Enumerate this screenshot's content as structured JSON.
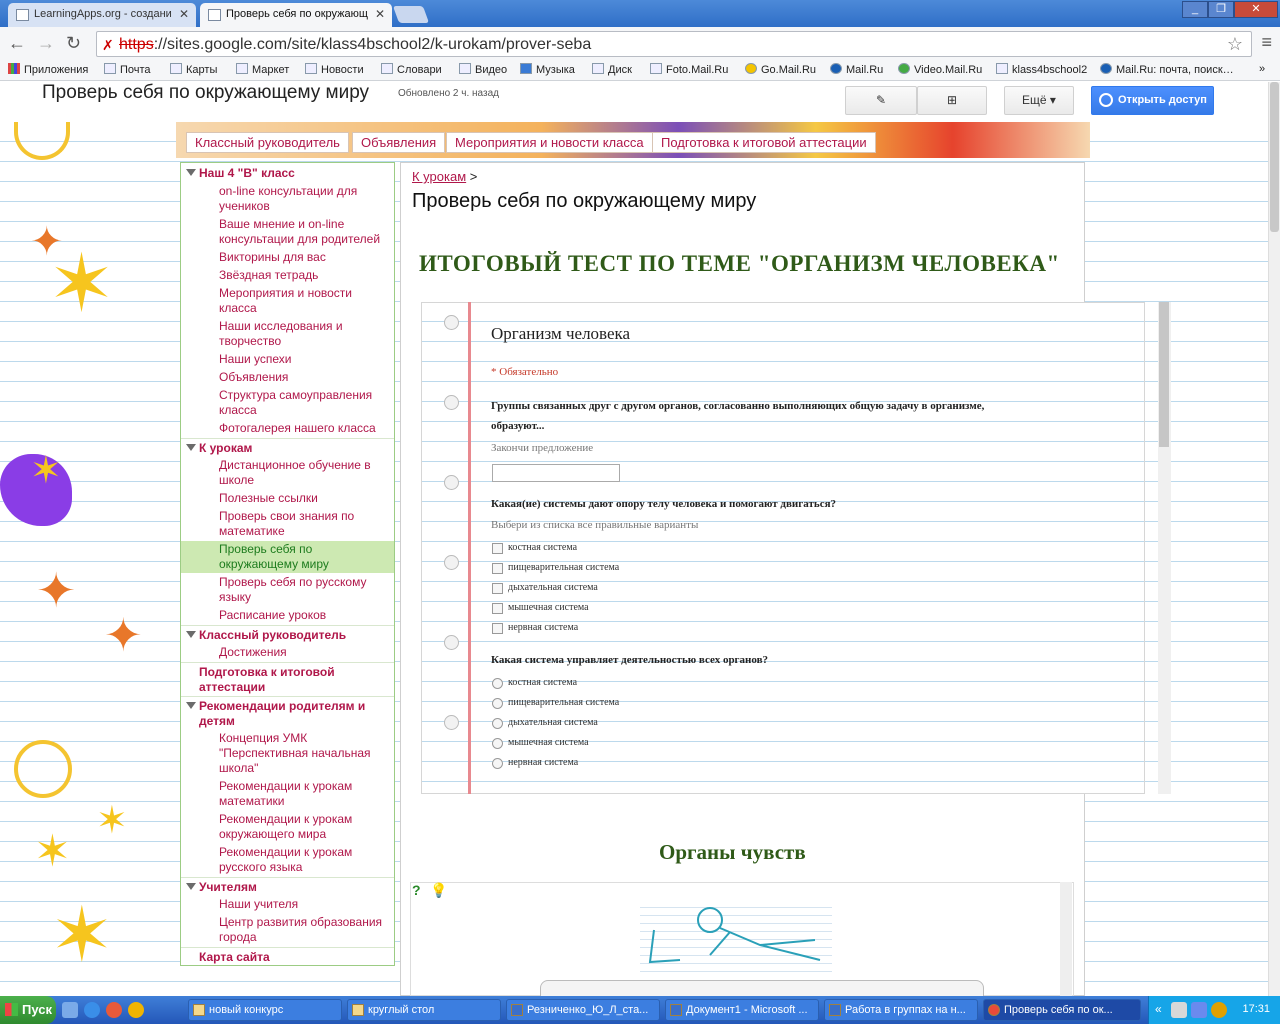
{
  "browser": {
    "tabs": [
      {
        "label": "LearningApps.org - создани",
        "active": false
      },
      {
        "label": "Проверь себя по окружающ",
        "active": true
      }
    ],
    "url_scheme": "https",
    "url_rest": "://sites.google.com/site/klass4bschool2/k-urokam/prover-seba",
    "bookmarks": [
      "Приложения",
      "Почта",
      "Карты",
      "Маркет",
      "Новости",
      "Словари",
      "Видео",
      "Музыка",
      "Диск",
      "Foto.Mail.Ru",
      "Go.Mail.Ru",
      "Mail.Ru",
      "Video.Mail.Ru",
      "klass4bschool2",
      "Mail.Ru: почта, поиск…"
    ],
    "bookmarks_more": "»"
  },
  "site": {
    "title": "Проверь себя по окружающему миру",
    "updated": "Обновлено 2 ч. назад",
    "more_label": "Ещё",
    "share_label": "Открыть доступ",
    "nav_tabs": [
      "Классный руководитель",
      "Объявления",
      "Мероприятия и новости класса",
      "Подготовка к итоговой аттестации"
    ]
  },
  "sidebar": {
    "items": [
      {
        "label": "Наш 4 \"В\" класс",
        "type": "head"
      },
      {
        "label": "on-line консультации для учеников",
        "type": "item"
      },
      {
        "label": "Ваше мнение и on-line консультации для родителей",
        "type": "item"
      },
      {
        "label": "Викторины для вас",
        "type": "item"
      },
      {
        "label": "Звёздная тетрадь",
        "type": "item"
      },
      {
        "label": "Мероприятия и новости класса",
        "type": "item"
      },
      {
        "label": "Наши исследования и творчество",
        "type": "item"
      },
      {
        "label": "Наши успехи",
        "type": "item"
      },
      {
        "label": "Объявления",
        "type": "item"
      },
      {
        "label": "Структура самоуправления класса",
        "type": "item"
      },
      {
        "label": "Фотогалерея нашего класса",
        "type": "item"
      },
      {
        "label": "К урокам",
        "type": "head"
      },
      {
        "label": "Дистанционное обучение в школе",
        "type": "item"
      },
      {
        "label": "Полезные ссылки",
        "type": "item"
      },
      {
        "label": "Проверь свои знания по математике",
        "type": "item"
      },
      {
        "label": "Проверь себя по окружающему миру",
        "type": "item"
      },
      {
        "label": "Проверь себя по русскому языку",
        "type": "item"
      },
      {
        "label": "Расписание уроков",
        "type": "item"
      },
      {
        "label": "Классный руководитель",
        "type": "head"
      },
      {
        "label": "Достижения",
        "type": "item"
      },
      {
        "label": "Подготовка к итоговой аттестации",
        "type": "head"
      },
      {
        "label": "Рекомендации родителям и детям",
        "type": "head"
      },
      {
        "label": "Концепция УМК \"Перспективная начальная школа\"",
        "type": "item"
      },
      {
        "label": "Рекомендации к урокам математики",
        "type": "item"
      },
      {
        "label": "Рекомендации к урокам окружающего мира",
        "type": "item"
      },
      {
        "label": "Рекомендации к урокам русского языка",
        "type": "item"
      },
      {
        "label": "Учителям",
        "type": "head"
      },
      {
        "label": "Наши учителя",
        "type": "item"
      },
      {
        "label": "Центр развития образования города",
        "type": "item"
      },
      {
        "label": "Карта сайта",
        "type": "head"
      }
    ]
  },
  "content": {
    "breadcrumb_link": "К урокам",
    "breadcrumb_sep": ">",
    "page_title": "Проверь себя по окружающему миру",
    "test_heading": "ИТОГОВЫЙ ТЕСТ ПО ТЕМЕ \"ОРГАНИЗМ ЧЕЛОВЕКА\"",
    "section2_heading": "Органы чувств"
  },
  "form": {
    "title": "Организм человека",
    "required_note": "* Обязательно",
    "q1": "Группы связанных друг с другом органов, согласованно выполняющих общую задачу в организме,",
    "q1_cont": "образуют...",
    "q1_help": "Закончи предложение",
    "q2": "Какая(ие) системы дают опору телу человека и помогают двигаться?",
    "q2_help": "Выбери из списка все правильные варианты",
    "q2_options": [
      "костная система",
      "пищеварительная система",
      "дыхательная система",
      "мышечная система",
      "нервная система"
    ],
    "q3": "Какая система управляет деятельностью всех органов?",
    "q3_options": [
      "костная система",
      "пищеварительная система",
      "дыхательная система",
      "мышечная система",
      "нервная система"
    ]
  },
  "taskbar": {
    "start_label": "Пуск",
    "tasks": [
      {
        "label": "новый конкурс",
        "active": false
      },
      {
        "label": "круглый стол",
        "active": false
      },
      {
        "label": "Резниченко_Ю_Л_ста...",
        "active": false
      },
      {
        "label": "Документ1 - Microsoft ...",
        "active": false
      },
      {
        "label": "Работа в группах на н...",
        "active": false
      },
      {
        "label": "Проверь себя по ок...",
        "active": true
      }
    ],
    "clock": "17:31"
  }
}
